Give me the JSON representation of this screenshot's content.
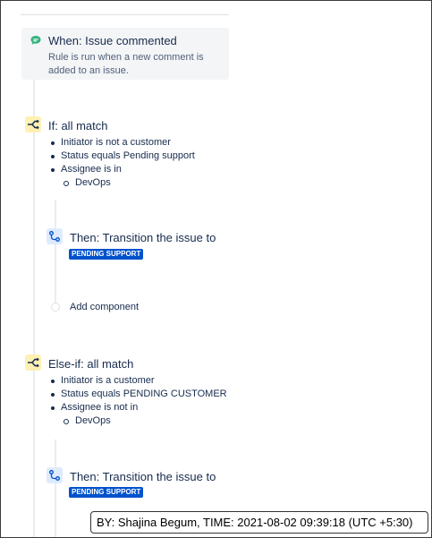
{
  "trigger": {
    "icon": "comment-icon",
    "title": "When: Issue commented",
    "description": "Rule is run when a new comment is added to an issue."
  },
  "if_block": {
    "icon": "branch-icon",
    "title": "If: all match",
    "conditions": [
      "Initiator is not a customer",
      "Status equals Pending support",
      "Assignee is in"
    ],
    "sub_item": "DevOps"
  },
  "then_1": {
    "icon": "transition-icon",
    "title": "Then: Transition the issue to",
    "status": "PENDING SUPPORT"
  },
  "add_component": {
    "label": "Add component"
  },
  "elseif_block": {
    "icon": "branch-icon",
    "title": "Else-if: all match",
    "conditions": [
      "Initiator is a customer",
      "Status equals PENDING CUSTOMER",
      "Assignee is not in"
    ],
    "sub_item": "DevOps"
  },
  "then_2": {
    "icon": "transition-icon",
    "title": "Then: Transition the issue to",
    "status": "PENDING SUPPORT"
  },
  "stamp": {
    "text": "BY: Shajina Begum, TIME: 2021-08-02 09:39:18 (UTC +5:30)"
  },
  "colors": {
    "condition_bg": "#fff0b3",
    "action_bg": "#deebff",
    "lozenge_bg": "#0052cc",
    "trigger_icon": "#36b37e"
  }
}
